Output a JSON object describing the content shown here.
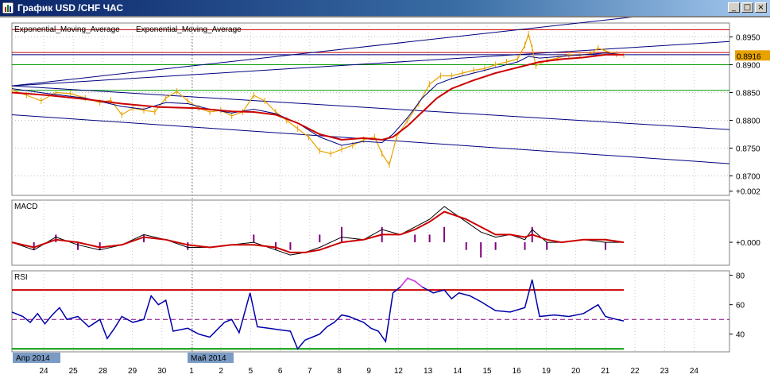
{
  "window": {
    "title": "График USD /CHF ЧАС",
    "buttons": {
      "minimize": "_",
      "maximize": "□",
      "close": "×"
    }
  },
  "chart_data": [
    {
      "type": "line",
      "name": "price",
      "legend": [
        "Exponential_Moving_Average",
        "Exponential_Moving_Average"
      ],
      "legend_colors": [
        "#000080",
        "#cc0000"
      ],
      "ylim": [
        0.8665,
        0.8975
      ],
      "yticks": [
        "0.8950",
        "0.8900",
        "0.8850",
        "0.8800",
        "0.8750",
        "0.8700"
      ],
      "current_price": "0.8916",
      "colors": {
        "price": "#e8a200",
        "ema_fast": "#000080",
        "ema_slow": "#cc0000"
      },
      "price_path": [
        [
          0,
          0.8855
        ],
        [
          4,
          0.8845
        ],
        [
          8,
          0.8835
        ],
        [
          12,
          0.885
        ],
        [
          16,
          0.8848
        ],
        [
          20,
          0.884
        ],
        [
          24,
          0.8832
        ],
        [
          27,
          0.8836
        ],
        [
          30,
          0.881
        ],
        [
          33,
          0.8822
        ],
        [
          36,
          0.8818
        ],
        [
          39,
          0.8815
        ],
        [
          42,
          0.884
        ],
        [
          45,
          0.8852
        ],
        [
          48,
          0.8835
        ],
        [
          51,
          0.8822
        ],
        [
          54,
          0.8815
        ],
        [
          57,
          0.8818
        ],
        [
          60,
          0.8808
        ],
        [
          63,
          0.8815
        ],
        [
          66,
          0.8845
        ],
        [
          69,
          0.8835
        ],
        [
          72,
          0.8815
        ],
        [
          75,
          0.88
        ],
        [
          78,
          0.8785
        ],
        [
          81,
          0.877
        ],
        [
          84,
          0.8745
        ],
        [
          87,
          0.874
        ],
        [
          90,
          0.8748
        ],
        [
          93,
          0.8755
        ],
        [
          96,
          0.8765
        ],
        [
          99,
          0.877
        ],
        [
          101,
          0.874
        ],
        [
          103,
          0.872
        ],
        [
          105,
          0.877
        ],
        [
          108,
          0.88
        ],
        [
          111,
          0.883
        ],
        [
          114,
          0.8865
        ],
        [
          117,
          0.888
        ],
        [
          120,
          0.888
        ],
        [
          123,
          0.8885
        ],
        [
          126,
          0.889
        ],
        [
          129,
          0.8893
        ],
        [
          132,
          0.89
        ],
        [
          135,
          0.8905
        ],
        [
          138,
          0.891
        ],
        [
          140,
          0.8935
        ],
        [
          141,
          0.8955
        ],
        [
          142,
          0.893
        ],
        [
          143,
          0.8898
        ],
        [
          146,
          0.8908
        ],
        [
          149,
          0.8912
        ],
        [
          152,
          0.8918
        ],
        [
          155,
          0.8917
        ],
        [
          158,
          0.892
        ],
        [
          160,
          0.893
        ],
        [
          162,
          0.8925
        ],
        [
          165,
          0.8919
        ],
        [
          167,
          0.8918
        ]
      ],
      "ema_fast_path": [
        [
          0,
          0.8857
        ],
        [
          10,
          0.8848
        ],
        [
          20,
          0.884
        ],
        [
          30,
          0.8825
        ],
        [
          36,
          0.882
        ],
        [
          42,
          0.8832
        ],
        [
          48,
          0.883
        ],
        [
          54,
          0.882
        ],
        [
          60,
          0.8813
        ],
        [
          66,
          0.882
        ],
        [
          72,
          0.8812
        ],
        [
          78,
          0.8795
        ],
        [
          84,
          0.877
        ],
        [
          90,
          0.8755
        ],
        [
          96,
          0.8762
        ],
        [
          101,
          0.876
        ],
        [
          104,
          0.8775
        ],
        [
          108,
          0.8805
        ],
        [
          112,
          0.884
        ],
        [
          116,
          0.8865
        ],
        [
          120,
          0.8875
        ],
        [
          126,
          0.8885
        ],
        [
          132,
          0.8895
        ],
        [
          138,
          0.8905
        ],
        [
          141,
          0.8915
        ],
        [
          144,
          0.8912
        ],
        [
          150,
          0.8915
        ],
        [
          156,
          0.8918
        ],
        [
          162,
          0.8921
        ],
        [
          167,
          0.8918
        ]
      ],
      "ema_slow_path": [
        [
          0,
          0.885
        ],
        [
          10,
          0.8845
        ],
        [
          20,
          0.8838
        ],
        [
          30,
          0.883
        ],
        [
          40,
          0.8824
        ],
        [
          50,
          0.8822
        ],
        [
          60,
          0.8816
        ],
        [
          66,
          0.8815
        ],
        [
          72,
          0.881
        ],
        [
          78,
          0.8795
        ],
        [
          84,
          0.8775
        ],
        [
          90,
          0.8765
        ],
        [
          96,
          0.8768
        ],
        [
          101,
          0.8765
        ],
        [
          104,
          0.877
        ],
        [
          108,
          0.879
        ],
        [
          112,
          0.8815
        ],
        [
          116,
          0.884
        ],
        [
          120,
          0.8857
        ],
        [
          126,
          0.8872
        ],
        [
          132,
          0.8885
        ],
        [
          138,
          0.8895
        ],
        [
          141,
          0.89
        ],
        [
          144,
          0.8905
        ],
        [
          150,
          0.891
        ],
        [
          156,
          0.8913
        ],
        [
          162,
          0.8918
        ],
        [
          167,
          0.8918
        ]
      ],
      "hlines": [
        {
          "y": 0.8963,
          "color": "#cc0000"
        },
        {
          "y": 0.8922,
          "color": "#cc0000"
        },
        {
          "y": 0.8918,
          "color": "#000080"
        },
        {
          "y": 0.89,
          "color": "#009900"
        },
        {
          "y": 0.8854,
          "color": "#009900"
        }
      ],
      "trendlines": [
        {
          "x1": 0,
          "y1": 0.8862,
          "x2": 167,
          "y2": 0.8984,
          "color": "#000080"
        },
        {
          "x1": 0,
          "y1": 0.8862,
          "x2": 167,
          "y2": 0.893,
          "color": "#000080"
        },
        {
          "x1": 0,
          "y1": 0.8862,
          "x2": 167,
          "y2": 0.8795,
          "color": "#000080"
        },
        {
          "x1": 0,
          "y1": 0.881,
          "x2": 167,
          "y2": 0.8735,
          "color": "#000080"
        }
      ]
    },
    {
      "type": "line",
      "name": "MACD",
      "title": "MACD",
      "ylim": [
        -0.0009,
        0.00165
      ],
      "yticks": [
        "+0.002",
        "+0.000"
      ],
      "macd_path": [
        [
          0,
          0.0
        ],
        [
          6,
          -0.0003
        ],
        [
          12,
          0.0002
        ],
        [
          18,
          -0.0001
        ],
        [
          24,
          -0.0003
        ],
        [
          30,
          -0.0001
        ],
        [
          36,
          0.0003
        ],
        [
          42,
          0.0001
        ],
        [
          48,
          -0.0002
        ],
        [
          54,
          -0.0002
        ],
        [
          60,
          -0.0001
        ],
        [
          66,
          0.0
        ],
        [
          72,
          -0.0003
        ],
        [
          76,
          -0.0005
        ],
        [
          80,
          -0.0004
        ],
        [
          84,
          -0.0002
        ],
        [
          90,
          0.0002
        ],
        [
          96,
          0.0001
        ],
        [
          101,
          0.0005
        ],
        [
          106,
          0.0003
        ],
        [
          110,
          0.0006
        ],
        [
          114,
          0.0009
        ],
        [
          118,
          0.0014
        ],
        [
          124,
          0.0008
        ],
        [
          128,
          0.0004
        ],
        [
          132,
          0.0002
        ],
        [
          136,
          0.0003
        ],
        [
          140,
          0.0001
        ],
        [
          142,
          0.0005
        ],
        [
          146,
          0.0
        ],
        [
          150,
          0.0
        ],
        [
          156,
          0.0001
        ],
        [
          162,
          0.0
        ],
        [
          167,
          0.0
        ]
      ],
      "signal_path": [
        [
          0,
          0.0
        ],
        [
          6,
          -0.0002
        ],
        [
          12,
          0.0001
        ],
        [
          18,
          0.0
        ],
        [
          24,
          -0.0002
        ],
        [
          30,
          -0.0001
        ],
        [
          36,
          0.0002
        ],
        [
          42,
          0.0001
        ],
        [
          48,
          -0.0001
        ],
        [
          54,
          -0.0002
        ],
        [
          60,
          -0.0001
        ],
        [
          66,
          -0.0001
        ],
        [
          72,
          -0.0002
        ],
        [
          76,
          -0.0004
        ],
        [
          80,
          -0.0004
        ],
        [
          84,
          -0.0003
        ],
        [
          90,
          0.0
        ],
        [
          96,
          0.0001
        ],
        [
          101,
          0.0003
        ],
        [
          106,
          0.0003
        ],
        [
          110,
          0.0005
        ],
        [
          114,
          0.0008
        ],
        [
          118,
          0.0012
        ],
        [
          124,
          0.0009
        ],
        [
          128,
          0.0006
        ],
        [
          132,
          0.0003
        ],
        [
          136,
          0.0003
        ],
        [
          140,
          0.0002
        ],
        [
          142,
          0.0003
        ],
        [
          146,
          0.0001
        ],
        [
          150,
          0.0
        ],
        [
          156,
          0.0001
        ],
        [
          162,
          0.0001
        ],
        [
          167,
          0.0
        ]
      ],
      "colors": {
        "macd": "#000000",
        "signal": "#cc0000",
        "hist": "#800080"
      }
    },
    {
      "type": "line",
      "name": "RSI",
      "title": "RSI",
      "ylim": [
        28,
        83
      ],
      "yticks": [
        "80",
        "60",
        "40"
      ],
      "levels": [
        {
          "y": 70,
          "color": "#cc0000"
        },
        {
          "y": 50,
          "color": "#800080"
        },
        {
          "y": 30,
          "color": "#009900"
        }
      ],
      "path": [
        [
          0,
          55
        ],
        [
          3,
          52
        ],
        [
          5,
          48
        ],
        [
          7,
          54
        ],
        [
          9,
          47
        ],
        [
          11,
          53
        ],
        [
          13,
          58
        ],
        [
          15,
          50
        ],
        [
          18,
          52
        ],
        [
          21,
          45
        ],
        [
          24,
          50
        ],
        [
          26,
          37
        ],
        [
          28,
          44
        ],
        [
          30,
          52
        ],
        [
          33,
          48
        ],
        [
          36,
          50
        ],
        [
          38,
          66
        ],
        [
          40,
          60
        ],
        [
          42,
          63
        ],
        [
          44,
          42
        ],
        [
          48,
          44
        ],
        [
          51,
          40
        ],
        [
          54,
          38
        ],
        [
          56,
          43
        ],
        [
          58,
          48
        ],
        [
          60,
          50
        ],
        [
          62,
          41
        ],
        [
          65,
          68
        ],
        [
          67,
          45
        ],
        [
          70,
          44
        ],
        [
          73,
          43
        ],
        [
          76,
          42
        ],
        [
          78,
          30
        ],
        [
          80,
          36
        ],
        [
          82,
          38
        ],
        [
          84,
          40
        ],
        [
          86,
          45
        ],
        [
          88,
          48
        ],
        [
          90,
          53
        ],
        [
          92,
          52
        ],
        [
          96,
          48
        ],
        [
          98,
          44
        ],
        [
          100,
          42
        ],
        [
          102,
          35
        ],
        [
          104,
          68
        ],
        [
          106,
          72
        ],
        [
          108,
          78
        ],
        [
          110,
          76
        ],
        [
          112,
          72
        ],
        [
          115,
          68
        ],
        [
          118,
          70
        ],
        [
          120,
          64
        ],
        [
          122,
          68
        ],
        [
          125,
          66
        ],
        [
          128,
          62
        ],
        [
          132,
          56
        ],
        [
          136,
          55
        ],
        [
          140,
          58
        ],
        [
          142,
          77
        ],
        [
          144,
          52
        ],
        [
          148,
          53
        ],
        [
          152,
          52
        ],
        [
          156,
          54
        ],
        [
          160,
          60
        ],
        [
          162,
          52
        ],
        [
          165,
          50
        ],
        [
          167,
          49
        ]
      ],
      "overbought_color": "#e040e0",
      "line_color": "#0000aa"
    }
  ],
  "time_axis": {
    "labels": [
      "24",
      "25",
      "28",
      "29",
      "30",
      "1",
      "2",
      "5",
      "6",
      "7",
      "8",
      "9",
      "12",
      "13",
      "14",
      "15",
      "16",
      "19",
      "20",
      "21",
      "22",
      "23",
      "24"
    ],
    "month_labels": [
      "Апр 2014",
      "Май 2014"
    ]
  }
}
